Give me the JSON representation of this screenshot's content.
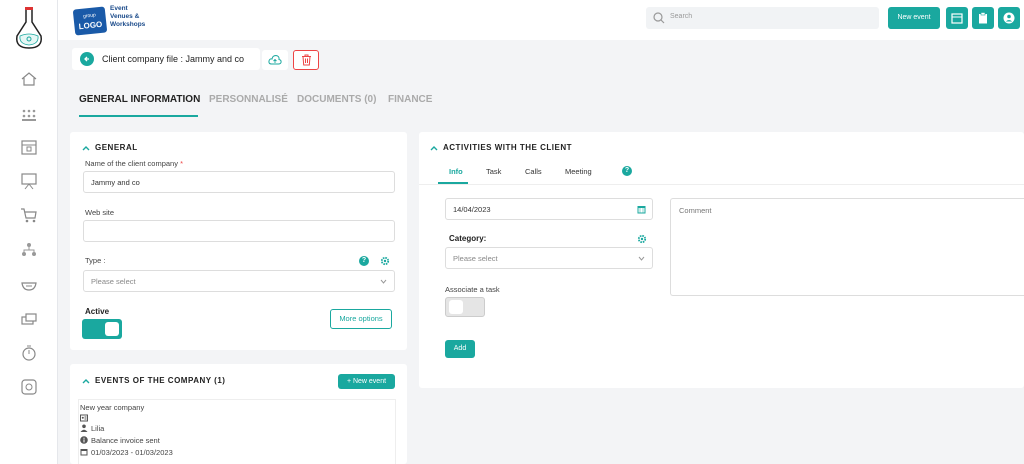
{
  "brand": {
    "badge_top": "group",
    "badge_main": "LOGO",
    "line1": "Event",
    "line2": "Venues &",
    "line3": "Workshops"
  },
  "search": {
    "placeholder": "Search"
  },
  "topbar": {
    "new_event_label": "New event"
  },
  "file": {
    "title": "Client company file : Jammy and co"
  },
  "tabs": [
    {
      "label": "GENERAL INFORMATION"
    },
    {
      "label": "PERSONNALISÉ"
    },
    {
      "label": "DOCUMENTS (0)"
    },
    {
      "label": "FINANCE"
    }
  ],
  "general": {
    "title": "GENERAL",
    "company_name_label": "Name of the client company",
    "required_mark": "*",
    "company_name_value": "Jammy and co",
    "website_label": "Web site",
    "website_value": "",
    "type_label": "Type :",
    "type_placeholder": "Please select",
    "active_label": "Active",
    "more_options_label": "More options"
  },
  "events": {
    "title": "EVENTS OF THE COMPANY (1)",
    "new_event_label": "+ New event",
    "items": [
      {
        "name": "New year company",
        "person": "Lilia",
        "status": "Balance invoice sent",
        "dates": "01/03/2023 - 01/03/2023"
      }
    ]
  },
  "activities": {
    "title": "ACTIVITIES WITH THE CLIENT",
    "tabs": [
      "Info",
      "Task",
      "Calls",
      "Meeting"
    ],
    "date_value": "14/04/2023",
    "category_label": "Category:",
    "category_placeholder": "Please select",
    "associate_label": "Associate a task",
    "add_label": "Add",
    "comment_placeholder": "Comment"
  },
  "colors": {
    "accent": "#1aa89f",
    "danger": "#e44444"
  }
}
